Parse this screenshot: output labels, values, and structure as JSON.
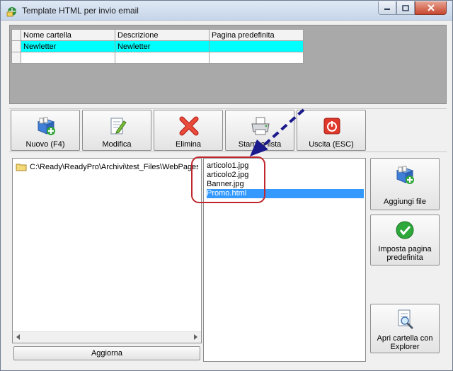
{
  "window": {
    "title": "Template HTML per invio email"
  },
  "grid": {
    "headers": [
      "Nome cartella",
      "Descrizione",
      "Pagina predefinita"
    ],
    "rows": [
      [
        "Newletter",
        "Newletter",
        ""
      ],
      [
        "",
        "",
        ""
      ]
    ]
  },
  "toolbar": {
    "new_label": "Nuovo (F4)",
    "edit_label": "Modifica",
    "delete_label": "Elimina",
    "print_label": "Stampa lista",
    "exit_label": "Uscita (ESC)"
  },
  "tree": {
    "path": "C:\\Ready\\ReadyPro\\Archivi\\test_Files\\WebPages"
  },
  "refresh_label": "Aggiorna",
  "files": [
    "articolo1.jpg",
    "articolo2.jpg",
    "Banner.jpg",
    "Promo.html"
  ],
  "selected_file": "Promo.html",
  "side": {
    "add_file_label": "Aggiungi file",
    "set_default_label_1": "Imposta pagina",
    "set_default_label_2": "predefinita",
    "open_folder_label_1": "Apri cartella con",
    "open_folder_label_2": "Explorer"
  },
  "colors": {
    "selected_row": "#00ffff",
    "selected_file": "#3399ff",
    "annotation_circle": "#c0272d",
    "annotation_arrow": "#1a1a8c"
  }
}
